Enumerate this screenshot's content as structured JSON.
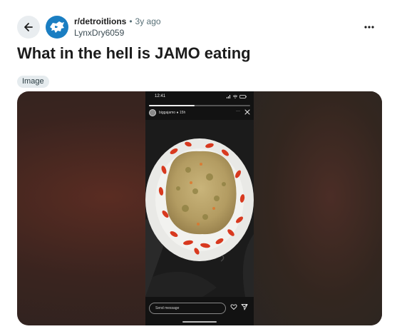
{
  "post": {
    "subreddit": "r/detroitlions",
    "separator": "•",
    "age": "3y ago",
    "author": "LynxDry6059",
    "title": "What in the hell is JAMO eating",
    "flair": "Image"
  },
  "icons": {
    "back": "arrow-left-icon",
    "subreddit_avatar": "lion-logo-icon",
    "more": "more-horizontal-icon"
  },
  "story": {
    "status_time": "12:41",
    "username": "biggajamo",
    "posted_ago": "15h",
    "more": "···",
    "progress": 0.45,
    "message_placeholder": "Send message"
  },
  "colors": {
    "subreddit_avatar_bg": "#1a7ec2",
    "flair_bg": "#e5ebee",
    "back_button_bg": "#e9edf0"
  }
}
